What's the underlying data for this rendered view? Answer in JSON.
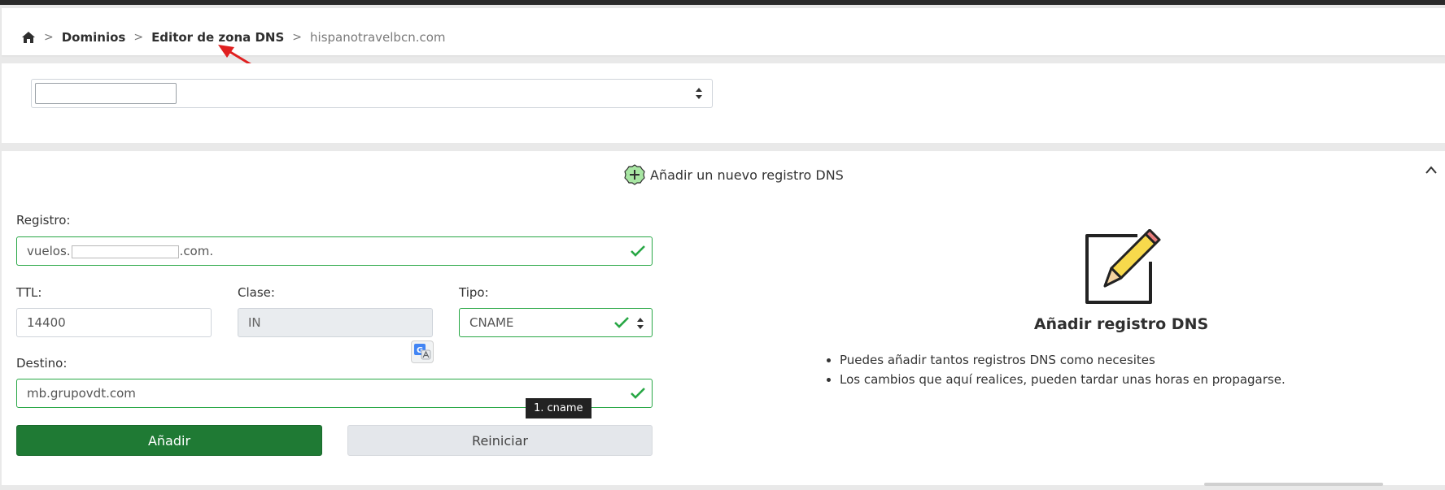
{
  "breadcrumb": {
    "home_icon": "home-icon",
    "separator": ">",
    "items": [
      "Dominios",
      "Editor de zona DNS"
    ],
    "current": "hispanotravelbcn.com"
  },
  "domain_selector": {
    "value": ""
  },
  "add_record": {
    "header": "Añadir un nuevo registro DNS",
    "registro": {
      "label": "Registro:",
      "prefix": "vuelos.",
      "suffix": ".com."
    },
    "ttl": {
      "label": "TTL:",
      "value": "14400"
    },
    "clase": {
      "label": "Clase:",
      "value": "IN"
    },
    "tipo": {
      "label": "Tipo:",
      "value": "CNAME"
    },
    "destino": {
      "label": "Destino:",
      "value": "mb.grupovdt.com"
    },
    "tooltip": "1. cname",
    "add_button": "Añadir",
    "reset_button": "Reiniciar"
  },
  "info": {
    "title": "Añadir registro DNS",
    "bullets": [
      "Puedes añadir tantos registros DNS como necesites",
      "Los cambios que aquí realices, pueden tardar unas horas en propagarse."
    ]
  },
  "colors": {
    "valid_green": "#28a745",
    "primary_button": "#1f7a34",
    "annotation_red": "#e02020",
    "plus_icon_fill": "#a8e6a3",
    "pencil_fill": "#f7d94c"
  }
}
